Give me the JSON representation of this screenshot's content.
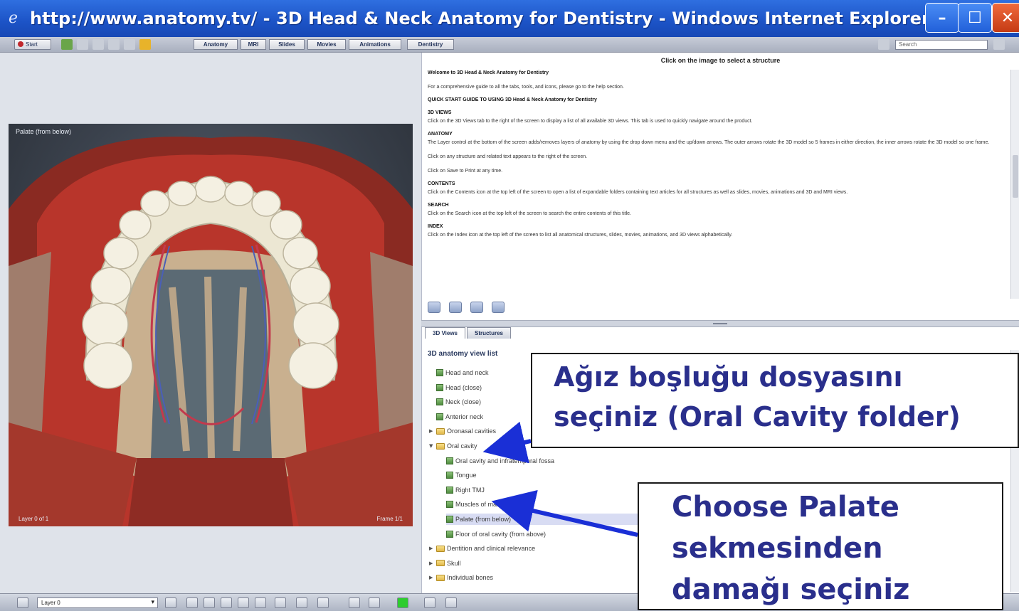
{
  "window": {
    "title": "http://www.anatomy.tv/ - 3D Head & Neck Anatomy for Dentistry - Windows Internet Explorer",
    "minimize": "–",
    "maximize": "☐",
    "close": "✕"
  },
  "toolbar": {
    "start_label": "Start",
    "nav_tabs": [
      "Anatomy",
      "MRI",
      "Slides",
      "Movies",
      "Animations",
      "Dentistry"
    ],
    "search_placeholder": "Search"
  },
  "viewer": {
    "view_title": "Palate (from below)",
    "layer_indicator": "Layer 0 of 1",
    "frame_indicator": "Frame 1/1"
  },
  "info_panel": {
    "hint": "Click on the image to select a structure",
    "welcome": "Welcome to 3D Head & Neck Anatomy for Dentistry",
    "intro": "For a comprehensive guide to all the tabs, tools, and icons, please go to the help section.",
    "quick_start": "QUICK START GUIDE TO USING 3D Head & Neck Anatomy for Dentistry",
    "sections": [
      {
        "heading": "3D VIEWS",
        "text": "Click on the 3D Views tab to the right of the screen to display a list of all available 3D views. This tab is used to quickly navigate around the product."
      },
      {
        "heading": "ANATOMY",
        "text": "The Layer control at the bottom of the screen adds/removes layers of anatomy by using the drop down menu and the up/down arrows. The outer arrows rotate the 3D model so 5 frames in either direction, the inner arrows rotate the 3D model so one frame."
      },
      {
        "heading": "",
        "text": "Click on any structure and related text appears to the right of the screen."
      },
      {
        "heading": "",
        "text": "Click on Save to Print at any time."
      },
      {
        "heading": "CONTENTS",
        "text": "Click on the Contents icon at the top left of the screen to open a list of expandable folders containing text articles for all structures as well as slides, movies, animations and 3D and MRI views."
      },
      {
        "heading": "SEARCH",
        "text": "Click on the Search icon at the top left of the screen to search the entire contents of this title."
      },
      {
        "heading": "INDEX",
        "text": "Click on the Index icon at the top left of the screen to list all anatomical structures, slides, movies, animations, and 3D views alphabetically."
      }
    ]
  },
  "tree_panel": {
    "tabs": [
      "3D Views",
      "Structures"
    ],
    "heading": "3D anatomy view list",
    "items": [
      {
        "label": "Head and neck",
        "kind": "leaf",
        "level": 1
      },
      {
        "label": "Head (close)",
        "kind": "leaf",
        "level": 1
      },
      {
        "label": "Neck (close)",
        "kind": "leaf",
        "level": 1
      },
      {
        "label": "Anterior neck",
        "kind": "leaf",
        "level": 1
      },
      {
        "label": "Oronasal cavities",
        "kind": "folder-collapsed",
        "level": 0
      },
      {
        "label": "Oral cavity",
        "kind": "folder-open",
        "level": 0
      },
      {
        "label": "Oral cavity and infratemporal fossa",
        "kind": "leaf",
        "level": 2
      },
      {
        "label": "Tongue",
        "kind": "leaf",
        "level": 2
      },
      {
        "label": "Right TMJ",
        "kind": "leaf",
        "level": 2
      },
      {
        "label": "Muscles of mastication",
        "kind": "leaf",
        "level": 2
      },
      {
        "label": "Palate (from below)",
        "kind": "leaf",
        "level": 2,
        "selected": true
      },
      {
        "label": "Floor of oral cavity (from above)",
        "kind": "leaf",
        "level": 2
      },
      {
        "label": "Dentition and clinical relevance",
        "kind": "folder-collapsed",
        "level": 0
      },
      {
        "label": "Skull",
        "kind": "folder-collapsed",
        "level": 0
      },
      {
        "label": "Individual bones",
        "kind": "folder-collapsed",
        "level": 0
      }
    ]
  },
  "controlbar": {
    "layer_select": "Layer 0"
  },
  "callouts": {
    "oral_line1": "Ağız boşluğu dosyasını",
    "oral_line2": "seçiniz (Oral Cavity folder)",
    "palate_line1": "Choose Palate",
    "palate_line2": "sekmesinden",
    "palate_line3": "damağı seçiniz"
  },
  "colors": {
    "titlebar": "#1c53c6",
    "callout_text": "#2a2f8c",
    "arrow": "#1a2fd6"
  }
}
